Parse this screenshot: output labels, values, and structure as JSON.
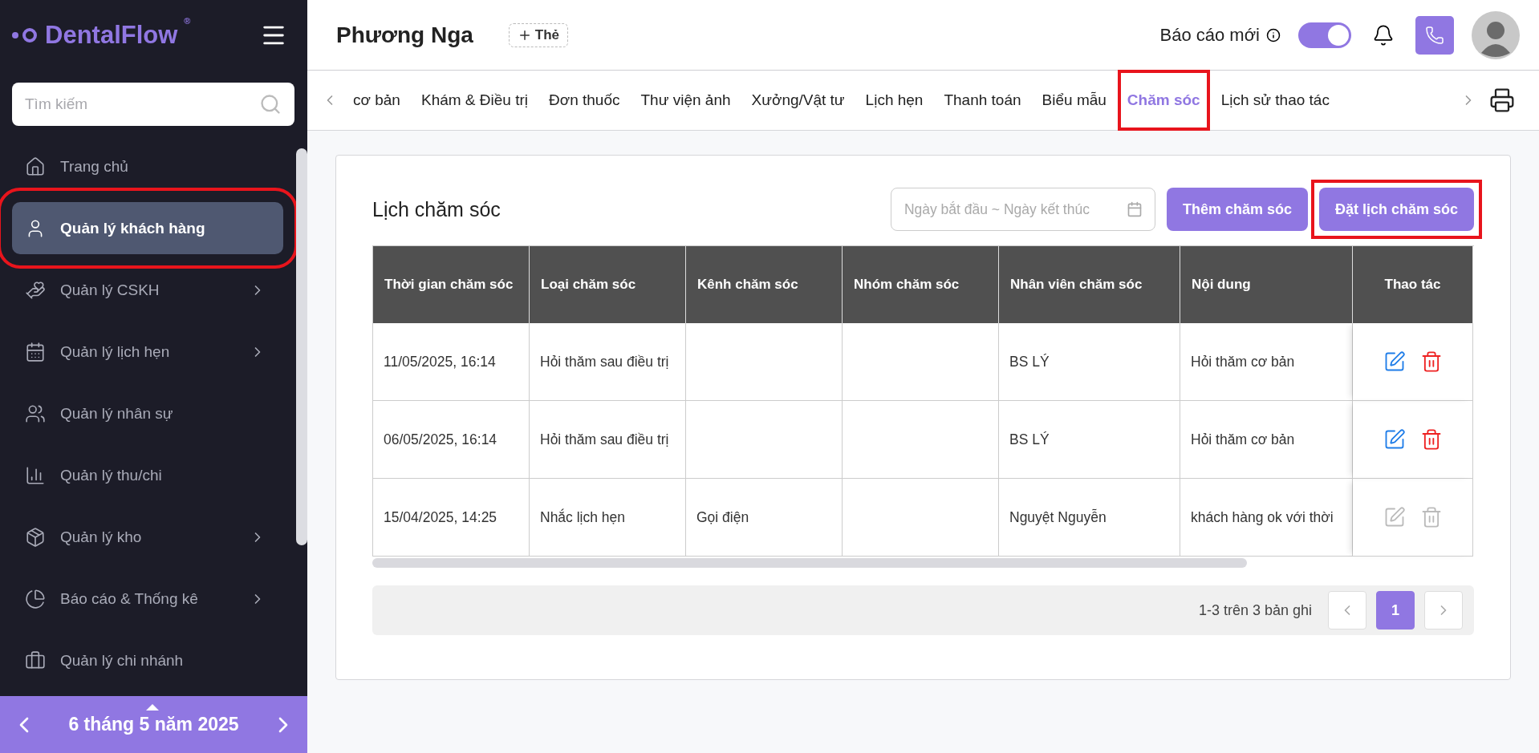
{
  "sidebar": {
    "logo": {
      "text": "DentalFlow",
      "mark": "®"
    },
    "search": {
      "placeholder": "Tìm kiếm"
    },
    "items": [
      {
        "label": "Trang chủ",
        "selected": false,
        "expandable": false,
        "highlighted": false
      },
      {
        "label": "Quản lý khách hàng",
        "selected": true,
        "expandable": false,
        "highlighted": true
      },
      {
        "label": "Quản lý CSKH",
        "selected": false,
        "expandable": true,
        "highlighted": false
      },
      {
        "label": "Quản lý lịch hẹn",
        "selected": false,
        "expandable": true,
        "highlighted": false
      },
      {
        "label": "Quản lý nhân sự",
        "selected": false,
        "expandable": false,
        "highlighted": false
      },
      {
        "label": "Quản lý thu/chi",
        "selected": false,
        "expandable": false,
        "highlighted": false
      },
      {
        "label": "Quản lý kho",
        "selected": false,
        "expandable": true,
        "highlighted": false
      },
      {
        "label": "Báo cáo & Thống kê",
        "selected": false,
        "expandable": true,
        "highlighted": false
      },
      {
        "label": "Quản lý chi nhánh",
        "selected": false,
        "expandable": false,
        "highlighted": false
      }
    ],
    "date_footer": {
      "text": "6 tháng 5 năm 2025"
    }
  },
  "header": {
    "patient_name": "Phương Nga",
    "tag_button": "Thẻ",
    "report_label": "Báo cáo mới",
    "report_toggle_on": true
  },
  "tabs": [
    {
      "label": "cơ bản",
      "selected": false,
      "highlighted": false
    },
    {
      "label": "Khám & Điều trị",
      "selected": false,
      "highlighted": false
    },
    {
      "label": "Đơn thuốc",
      "selected": false,
      "highlighted": false
    },
    {
      "label": "Thư viện ảnh",
      "selected": false,
      "highlighted": false
    },
    {
      "label": "Xưởng/Vật tư",
      "selected": false,
      "highlighted": false
    },
    {
      "label": "Lịch hẹn",
      "selected": false,
      "highlighted": false
    },
    {
      "label": "Thanh toán",
      "selected": false,
      "highlighted": false
    },
    {
      "label": "Biểu mẫu",
      "selected": false,
      "highlighted": false
    },
    {
      "label": "Chăm sóc",
      "selected": true,
      "highlighted": true
    },
    {
      "label": "Lịch sử thao tác",
      "selected": false,
      "highlighted": false
    }
  ],
  "care": {
    "title": "Lịch chăm sóc",
    "date_range": {
      "placeholder": "Ngày bắt đầu ~ Ngày kết thúc"
    },
    "buttons": [
      {
        "label": "Thêm chăm sóc",
        "highlighted": false
      },
      {
        "label": "Đặt lịch chăm sóc",
        "highlighted": true
      }
    ],
    "table": {
      "columns": [
        "Thời gian chăm sóc",
        "Loại chăm sóc",
        "Kênh chăm sóc",
        "Nhóm chăm sóc",
        "Nhân viên chăm sóc",
        "Nội dung",
        "Thao tác"
      ],
      "rows": [
        {
          "cells": [
            "11/05/2025, 16:14",
            "Hỏi thăm sau điều trị",
            "",
            "",
            "BS LÝ",
            "Hỏi thăm cơ bản"
          ],
          "actions_disabled": false
        },
        {
          "cells": [
            "06/05/2025, 16:14",
            "Hỏi thăm sau điều trị",
            "",
            "",
            "BS LÝ",
            "Hỏi thăm cơ bản"
          ],
          "actions_disabled": false
        },
        {
          "cells": [
            "15/04/2025, 14:25",
            "Nhắc lịch hẹn",
            "Gọi điện",
            "",
            "Nguyệt Nguyễn",
            "khách hàng ok với thời"
          ],
          "actions_disabled": true
        }
      ]
    },
    "pagination": {
      "summary": "1-3 trên 3 bản ghi",
      "pages": [
        {
          "label": "1",
          "selected": true
        }
      ]
    }
  }
}
